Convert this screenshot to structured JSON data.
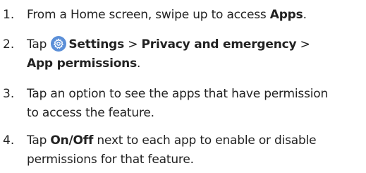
{
  "steps": [
    {
      "number": "1.",
      "parts": [
        "From a Home screen, swipe up to access ",
        "Apps",
        "."
      ]
    },
    {
      "number": "2.",
      "parts": [
        "Tap ",
        "Settings",
        " > ",
        "Privacy and emergency",
        " >",
        "App permissions",
        "."
      ],
      "icon": "settings-gear-icon"
    },
    {
      "number": "3.",
      "lines": [
        "Tap an option to see the apps that have permission",
        "to access the feature."
      ]
    },
    {
      "number": "4.",
      "parts": [
        "Tap ",
        "On/Off",
        " next to each app to enable or disable"
      ],
      "line2": "permissions for that feature."
    }
  ],
  "colors": {
    "text": "#222222",
    "icon_bg": "#5b8fd8"
  }
}
